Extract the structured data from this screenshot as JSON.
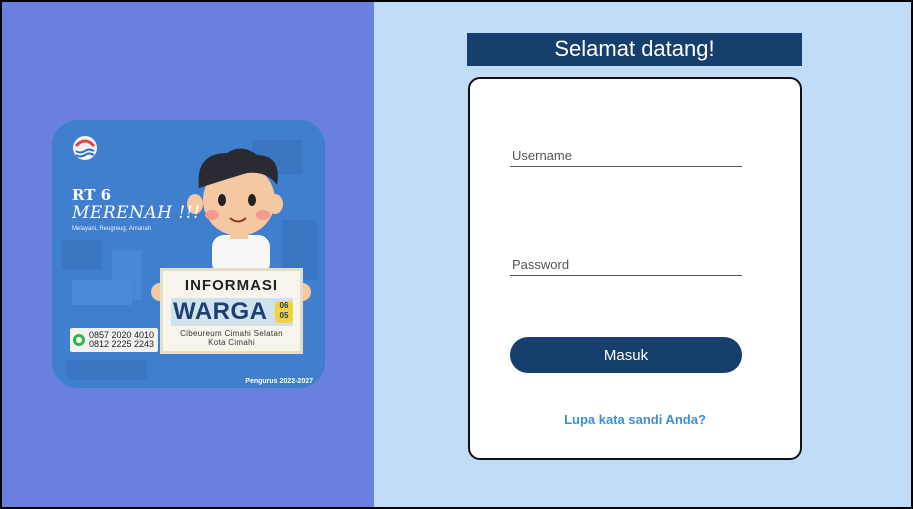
{
  "poster": {
    "title": "RT 6",
    "subtitle": "MERENAH !!!",
    "tagline": "Melayani, Reugreug, Amanah",
    "sign_title": "INFORMASI",
    "sign_word": "WARGA",
    "sign_badge": "06 05",
    "sign_location_1": "Cibeureum Cimahi Selatan",
    "sign_location_2": "Kota Cimahi",
    "phone_1": "0857 2020 4010",
    "phone_2": "0812 2225 2243",
    "footer": "Pengurus 2022-2027",
    "icons": [
      "emblem-icon",
      "whatsapp-icon"
    ]
  },
  "login": {
    "welcome": "Selamat datang!",
    "username_placeholder": "Username",
    "password_placeholder": "Password",
    "submit_label": "Masuk",
    "forgot_label": "Lupa kata sandi Anda?"
  },
  "colors": {
    "left_bg": "#6a80de",
    "right_bg": "#c1dcf6",
    "primary": "#163f6e",
    "link": "#3d8fd6"
  }
}
